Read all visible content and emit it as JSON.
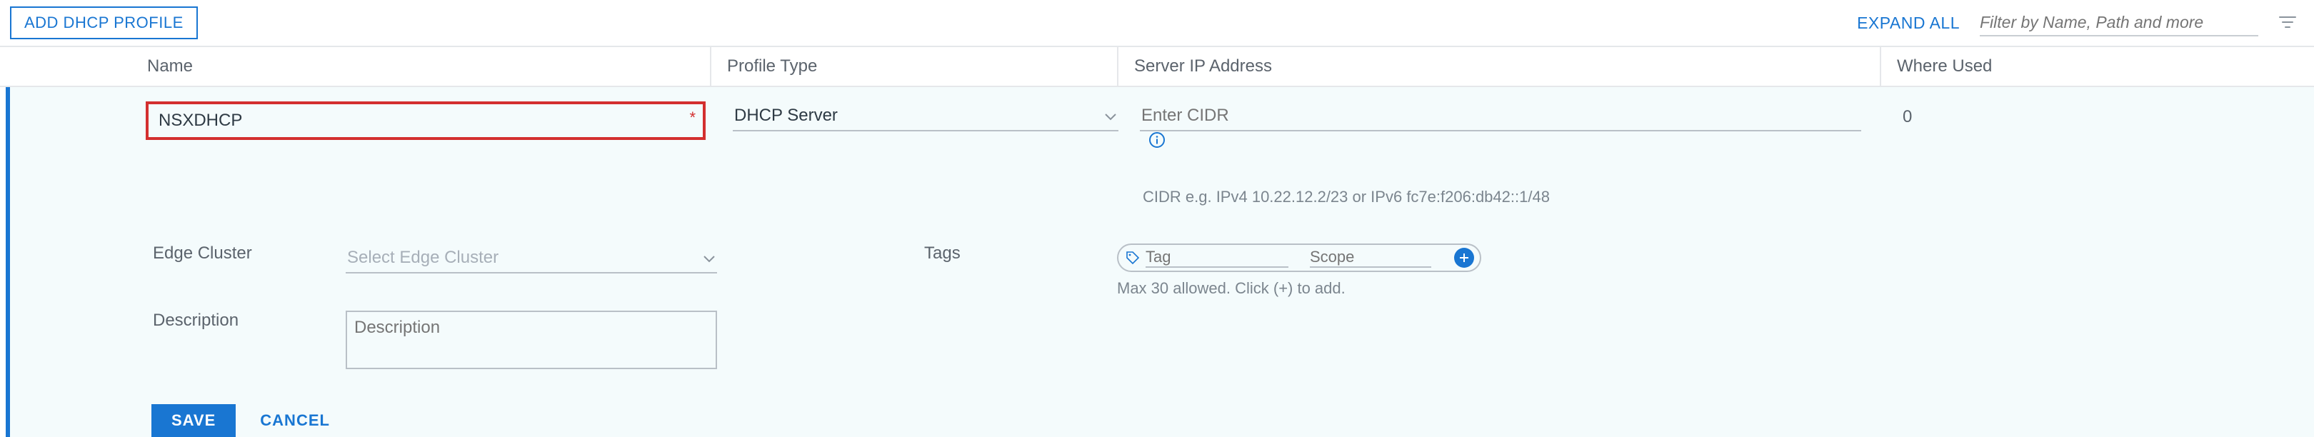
{
  "toolbar": {
    "add_profile_label": "ADD DHCP PROFILE",
    "expand_all_label": "EXPAND ALL",
    "filter_placeholder": "Filter by Name, Path and more"
  },
  "columns": {
    "name": "Name",
    "profile_type": "Profile Type",
    "server_ip": "Server IP Address",
    "where_used": "Where Used"
  },
  "row": {
    "name_value": "NSXDHCP",
    "profile_type_value": "DHCP Server",
    "server_ip_placeholder": "Enter CIDR",
    "server_ip_note": "CIDR e.g. IPv4 10.22.12.2/23 or IPv6 fc7e:f206:db42::1/48",
    "where_used_value": "0"
  },
  "fields": {
    "edge_cluster_label": "Edge Cluster",
    "edge_cluster_placeholder": "Select Edge Cluster",
    "description_label": "Description",
    "description_placeholder": "Description",
    "tags_label": "Tags",
    "tag_placeholder": "Tag",
    "scope_placeholder": "Scope",
    "tags_note": "Max 30 allowed. Click (+) to add."
  },
  "actions": {
    "save_label": "SAVE",
    "cancel_label": "CANCEL"
  }
}
